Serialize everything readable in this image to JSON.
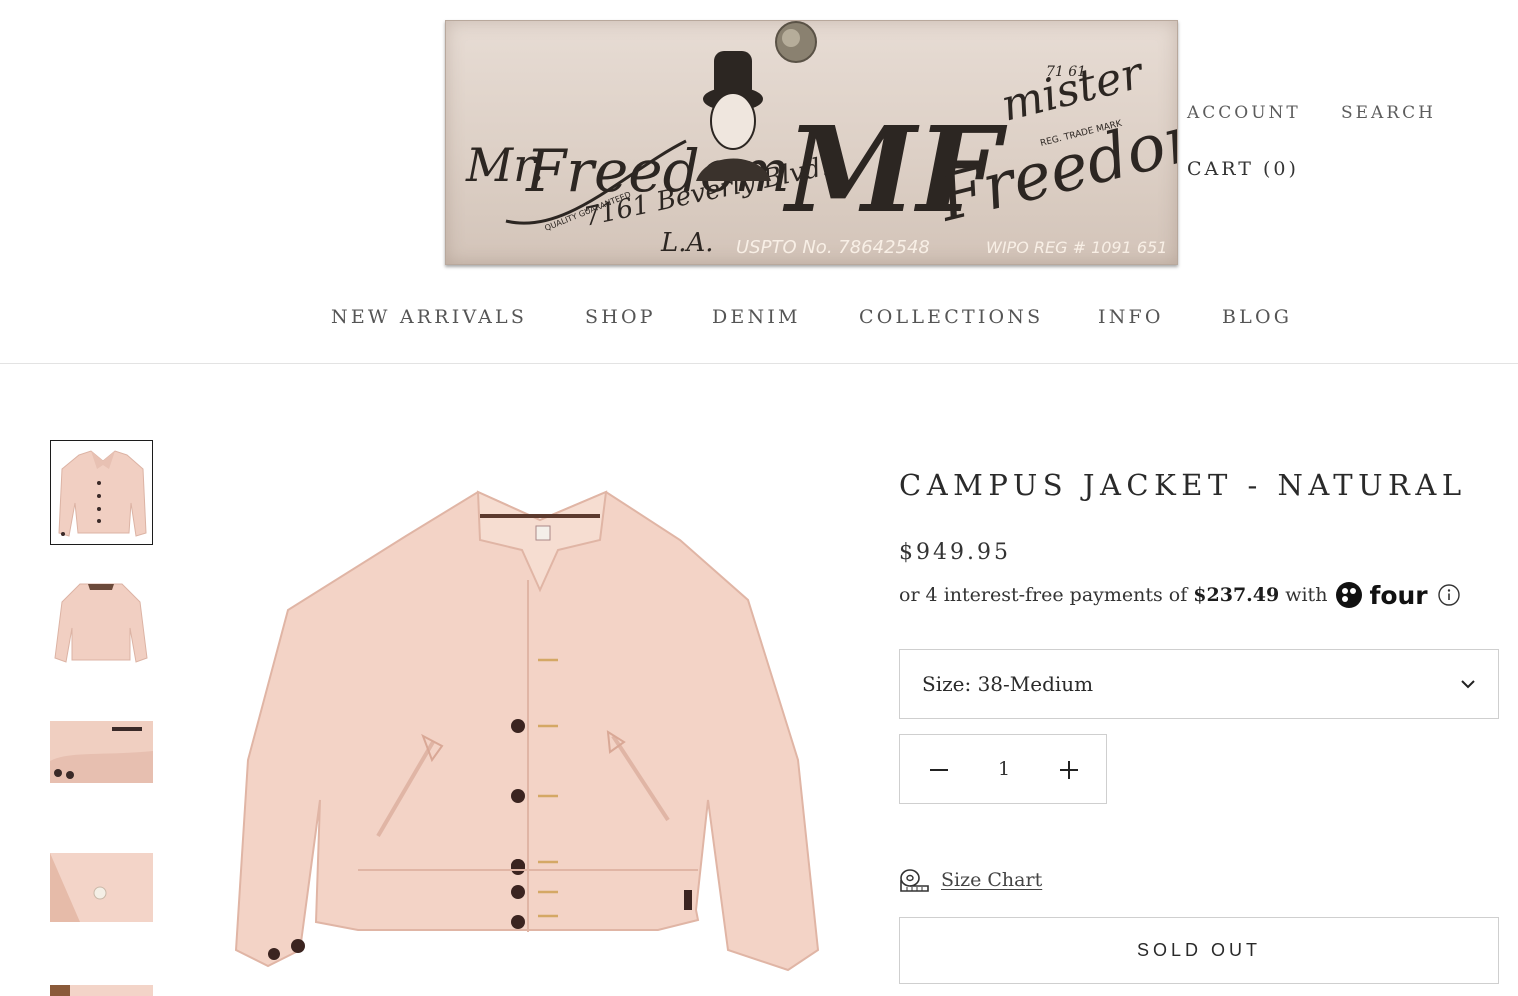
{
  "brand": {
    "logo_text": [
      "Mr. Freedom",
      "MF",
      "mister Freedom",
      "7161 Beverly Blvd.",
      "L.A.",
      "USPTO No. 78642548",
      "WIPO REG # 1091 651",
      "REG. TRADE MARK",
      "71 61",
      "QUALITY GUARANTEED"
    ]
  },
  "header": {
    "account_label": "ACCOUNT",
    "search_label": "SEARCH",
    "cart_label": "CART",
    "cart_count": "(0)"
  },
  "nav": {
    "items": [
      {
        "label": "NEW ARRIVALS"
      },
      {
        "label": "SHOP"
      },
      {
        "label": "DENIM"
      },
      {
        "label": "COLLECTIONS"
      },
      {
        "label": "INFO"
      },
      {
        "label": "BLOG"
      }
    ]
  },
  "gallery": {
    "thumbnails": [
      "front view",
      "back view",
      "cuff detail",
      "button detail",
      "label detail"
    ],
    "active_index": 0
  },
  "product": {
    "title": "CAMPUS JACKET - NATURAL",
    "price": "$949.95",
    "installment_prefix": "or 4 interest-free payments of",
    "installment_amount": "$237.49",
    "installment_with": "with",
    "installment_provider": "four",
    "size_label": "Size:",
    "size_value": "38-Medium",
    "quantity": "1",
    "size_chart_label": "Size Chart",
    "sold_out_label": "SOLD OUT"
  },
  "colors": {
    "logo_plate": "#ddd0c6",
    "jacket": "#f3d3c6",
    "text_primary": "#2a2a2a",
    "border": "#cfcfcf"
  }
}
